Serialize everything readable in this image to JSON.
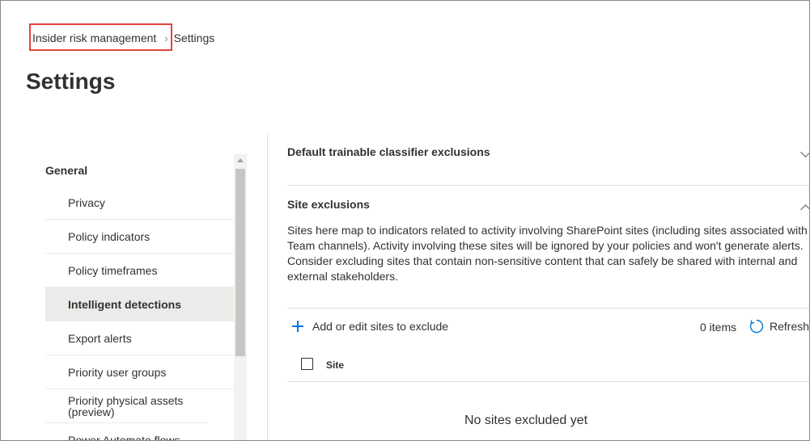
{
  "breadcrumb": {
    "root": "Insider risk management",
    "current": "Settings"
  },
  "page": {
    "title": "Settings"
  },
  "nav": {
    "section_title": "General",
    "items": [
      {
        "label": "Privacy"
      },
      {
        "label": "Policy indicators"
      },
      {
        "label": "Policy timeframes"
      },
      {
        "label": "Intelligent detections",
        "selected": true
      },
      {
        "label": "Export alerts"
      },
      {
        "label": "Priority user groups"
      },
      {
        "label": "Priority physical assets (preview)"
      },
      {
        "label": "Power Automate flows"
      }
    ]
  },
  "sections": {
    "classifier": {
      "title": "Default trainable classifier exclusions"
    },
    "site": {
      "title": "Site exclusions",
      "description": "Sites here map to indicators related to activity involving SharePoint sites (including sites associated with Team channels). Activity involving these sites will be ignored by your policies and won't generate alerts. Consider excluding sites that contain non-sensitive content that can safely be shared with internal and external stakeholders."
    }
  },
  "toolbar": {
    "add_label": "Add or edit sites to exclude",
    "items_count": "0 items",
    "refresh_label": "Refresh"
  },
  "table": {
    "column_site": "Site",
    "empty_message": "No sites excluded yet"
  },
  "colors": {
    "accent": "#0078d4",
    "highlight": "#e2443d",
    "selected_bg": "#edebe9"
  }
}
